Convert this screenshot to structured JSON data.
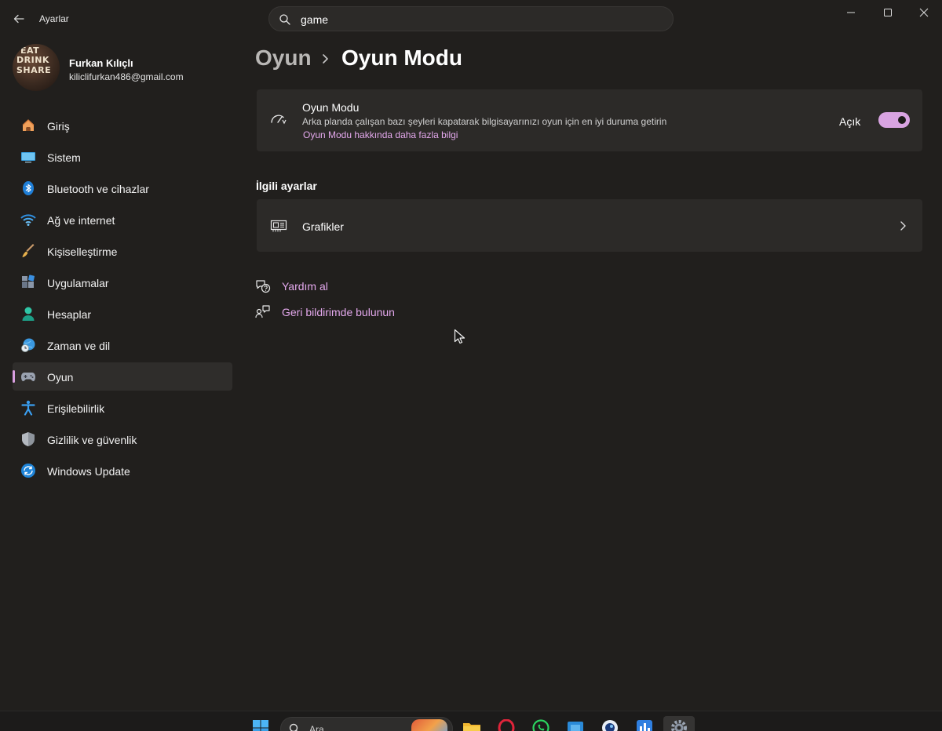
{
  "window": {
    "app_title": "Ayarlar",
    "search_value": "game"
  },
  "profile": {
    "name": "Furkan Kılıçlı",
    "email": "kiliclifurkan486@gmail.com",
    "avatar_text": [
      "EAT",
      "DRINK",
      "SHARE"
    ]
  },
  "sidebar": {
    "items": [
      {
        "label": "Giriş",
        "icon": "home-icon"
      },
      {
        "label": "Sistem",
        "icon": "system-icon"
      },
      {
        "label": "Bluetooth ve cihazlar",
        "icon": "bluetooth-icon"
      },
      {
        "label": "Ağ ve internet",
        "icon": "wifi-icon"
      },
      {
        "label": "Kişiselleştirme",
        "icon": "brush-icon"
      },
      {
        "label": "Uygulamalar",
        "icon": "apps-icon"
      },
      {
        "label": "Hesaplar",
        "icon": "accounts-icon"
      },
      {
        "label": "Zaman ve dil",
        "icon": "time-language-icon"
      },
      {
        "label": "Oyun",
        "icon": "gamepad-icon",
        "active": true
      },
      {
        "label": "Erişilebilirlik",
        "icon": "accessibility-icon"
      },
      {
        "label": "Gizlilik ve güvenlik",
        "icon": "shield-icon"
      },
      {
        "label": "Windows Update",
        "icon": "windows-update-icon"
      }
    ]
  },
  "breadcrumb": {
    "parent": "Oyun",
    "current": "Oyun Modu"
  },
  "game_mode": {
    "title": "Oyun Modu",
    "description": "Arka planda çalışan bazı şeyleri kapatarak bilgisayarınızı oyun için en iyi duruma getirin",
    "link": "Oyun Modu hakkında daha fazla bilgi",
    "toggle_label": "Açık",
    "toggle_on": true
  },
  "related": {
    "section_title": "İlgili ayarlar",
    "graphics_label": "Grafikler"
  },
  "help": {
    "get_help": "Yardım al",
    "feedback": "Geri bildirimde bulunun"
  },
  "taskbar": {
    "search_label": "Ara"
  },
  "colors": {
    "accent": "#d9a4e2",
    "link": "#e3a8ec",
    "background": "#211f1d",
    "card": "#2c2a28"
  }
}
